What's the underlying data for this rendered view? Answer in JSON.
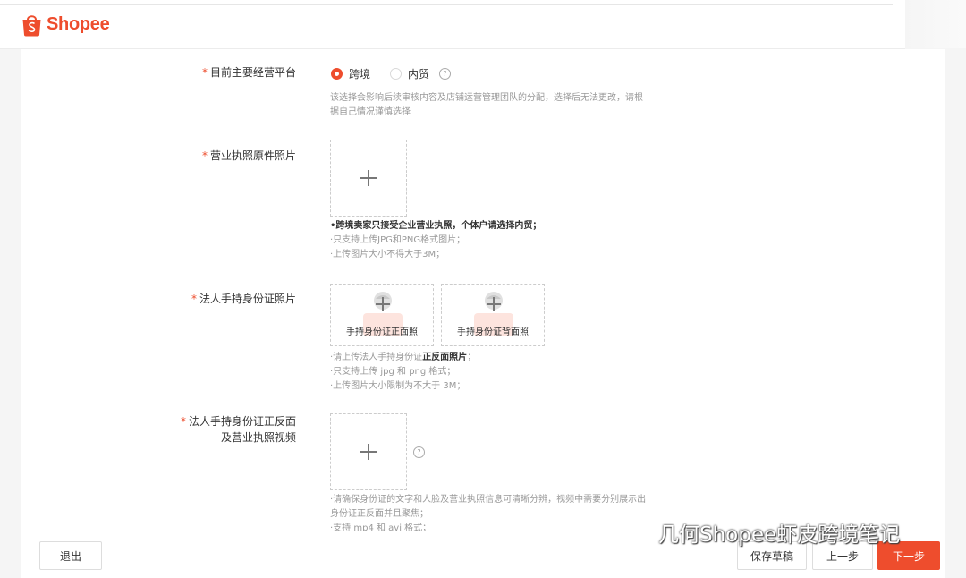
{
  "header": {
    "brand": "Shopee",
    "brand_color": "#ee4d2d"
  },
  "form": {
    "platform": {
      "label": "目前主要经营平台",
      "options": [
        {
          "label": "跨境",
          "selected": true
        },
        {
          "label": "内贸",
          "selected": false
        }
      ],
      "hint_line1": "该选择会影响后续审核内容及店铺运营管理团队的分配，选择后无法更改，请根",
      "hint_line2": "据自己情况谨慎选择"
    },
    "license": {
      "label": "营业执照原件照片",
      "hint_bold": "•跨境卖家只接受企业营业执照，个体户请选择内贸；",
      "hint_line2": "·只支持上传JPG和PNG格式图片；",
      "hint_line3": "·上传图片大小不得大于3M；"
    },
    "id_photo": {
      "label": "法人手持身份证照片",
      "front_caption": "手持身份证正面照",
      "back_caption": "手持身份证背面照",
      "hint_line1_pre": "·请上传法人手持身份证",
      "hint_line1_bold": "正反面照片",
      "hint_line1_post": "；",
      "hint_line2": "·只支持上传 jpg 和 png 格式；",
      "hint_line3": "·上传图片大小限制为不大于 3M；"
    },
    "video": {
      "label_line1": "法人手持身份证正反面",
      "label_line2": "及营业执照视频",
      "hint_line1": "·请确保身份证的文字和人脸及营业执照信息可清晰分辨，视频中需要分别展示出",
      "hint_line2": "身份证正反面并且聚焦；",
      "hint_line3": "·支持 mp4 和 avi 格式；"
    },
    "required_mark": "*"
  },
  "footer": {
    "exit_label": "退出",
    "save_draft_label": "保存草稿",
    "prev_label": "上一步",
    "next_label": "下一步"
  },
  "watermark": {
    "text": "几何Shopee虾皮跨境笔记"
  }
}
